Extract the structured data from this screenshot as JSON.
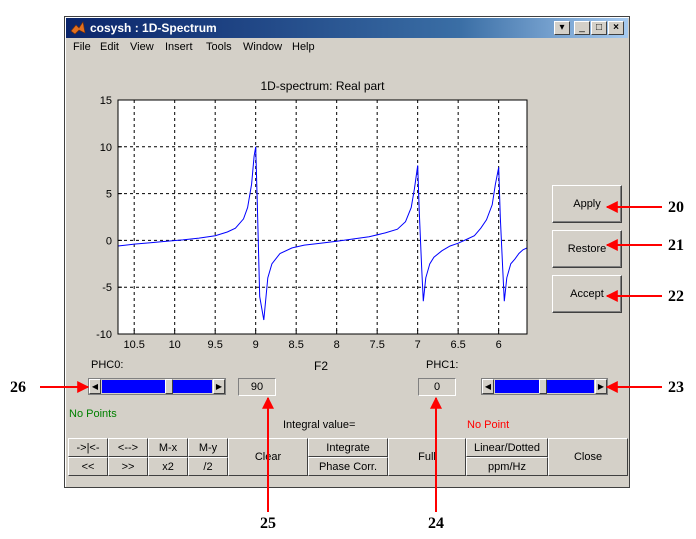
{
  "window": {
    "title": "cosysh : 1D-Spectrum"
  },
  "menu": [
    "File",
    "Edit",
    "View",
    "Insert",
    "Tools",
    "Window",
    "Help"
  ],
  "chart_data": {
    "type": "line",
    "title": "1D-spectrum: Real part",
    "xlabel": "F2",
    "ylabel": "",
    "xlim": [
      10.7,
      5.65
    ],
    "ylim": [
      -10,
      15
    ],
    "x_reversed": true,
    "grid": true,
    "x_ticks": [
      "10.5",
      "10",
      "9.5",
      "9",
      "8.5",
      "8",
      "7.5",
      "7",
      "6.5",
      "6"
    ],
    "y_ticks": [
      "15",
      "10",
      "5",
      "0",
      "-5",
      "-10"
    ],
    "series": [
      {
        "color": "#0000ff",
        "x": [
          10.7,
          10.5,
          10.3,
          10.1,
          9.9,
          9.7,
          9.5,
          9.35,
          9.25,
          9.15,
          9.1,
          9.05,
          9.02,
          9.0,
          8.98,
          8.95,
          8.9,
          8.85,
          8.8,
          8.7,
          8.55,
          8.4,
          8.2,
          8.0,
          7.8,
          7.6,
          7.4,
          7.25,
          7.15,
          7.08,
          7.04,
          7.0,
          6.98,
          6.95,
          6.93,
          6.9,
          6.85,
          6.8,
          6.7,
          6.6,
          6.5,
          6.4,
          6.3,
          6.22,
          6.15,
          6.08,
          6.04,
          6.0,
          5.98,
          5.95,
          5.93,
          5.9,
          5.85,
          5.8,
          5.75,
          5.7,
          5.65
        ],
        "y": [
          -0.6,
          -0.4,
          -0.25,
          -0.1,
          0.05,
          0.25,
          0.5,
          0.9,
          1.3,
          2.3,
          3.5,
          6.0,
          9.0,
          10.0,
          4.0,
          -6.0,
          -8.5,
          -4.0,
          -2.5,
          -1.4,
          -0.8,
          -0.5,
          -0.3,
          -0.1,
          0.15,
          0.4,
          0.8,
          1.2,
          2.0,
          3.5,
          5.5,
          8.0,
          3.0,
          -3.0,
          -6.5,
          -4.0,
          -2.5,
          -1.8,
          -1.1,
          -0.6,
          -0.3,
          0.1,
          0.5,
          1.3,
          2.2,
          3.8,
          6.0,
          7.8,
          2.5,
          -3.0,
          -6.5,
          -4.0,
          -2.5,
          -2.0,
          -1.4,
          -1.0,
          -0.8
        ]
      }
    ]
  },
  "side_buttons": {
    "apply": "Apply",
    "restore": "Restore",
    "accept": "Accept"
  },
  "controls": {
    "phc0_label": "PHC0:",
    "phc1_label": "PHC1:",
    "phc0_value": "90",
    "phc1_value": "0",
    "no_points_left": "No Points",
    "no_point_right": "No Point",
    "integral_label": "Integral value=",
    "colors": {
      "left_status": "#008000",
      "right_status": "#ff0000",
      "slider_track": "#0000ff"
    }
  },
  "toolbar": {
    "zoom_in_x": "->|<-",
    "zoom_out_x": "<-->",
    "mx": "M-x",
    "my": "M-y",
    "shift_left": "<<",
    "shift_right": ">>",
    "x2": "x2",
    "half": "/2",
    "clear": "Clear",
    "integrate": "Integrate",
    "phase_corr": "Phase Corr.",
    "full": "Full",
    "linear_dotted": "Linear/Dotted",
    "ppm_hz": "ppm/Hz",
    "close": "Close"
  },
  "callouts": {
    "c20": "20",
    "c21": "21",
    "c22": "22",
    "c23": "23",
    "c24": "24",
    "c25": "25",
    "c26": "26"
  }
}
